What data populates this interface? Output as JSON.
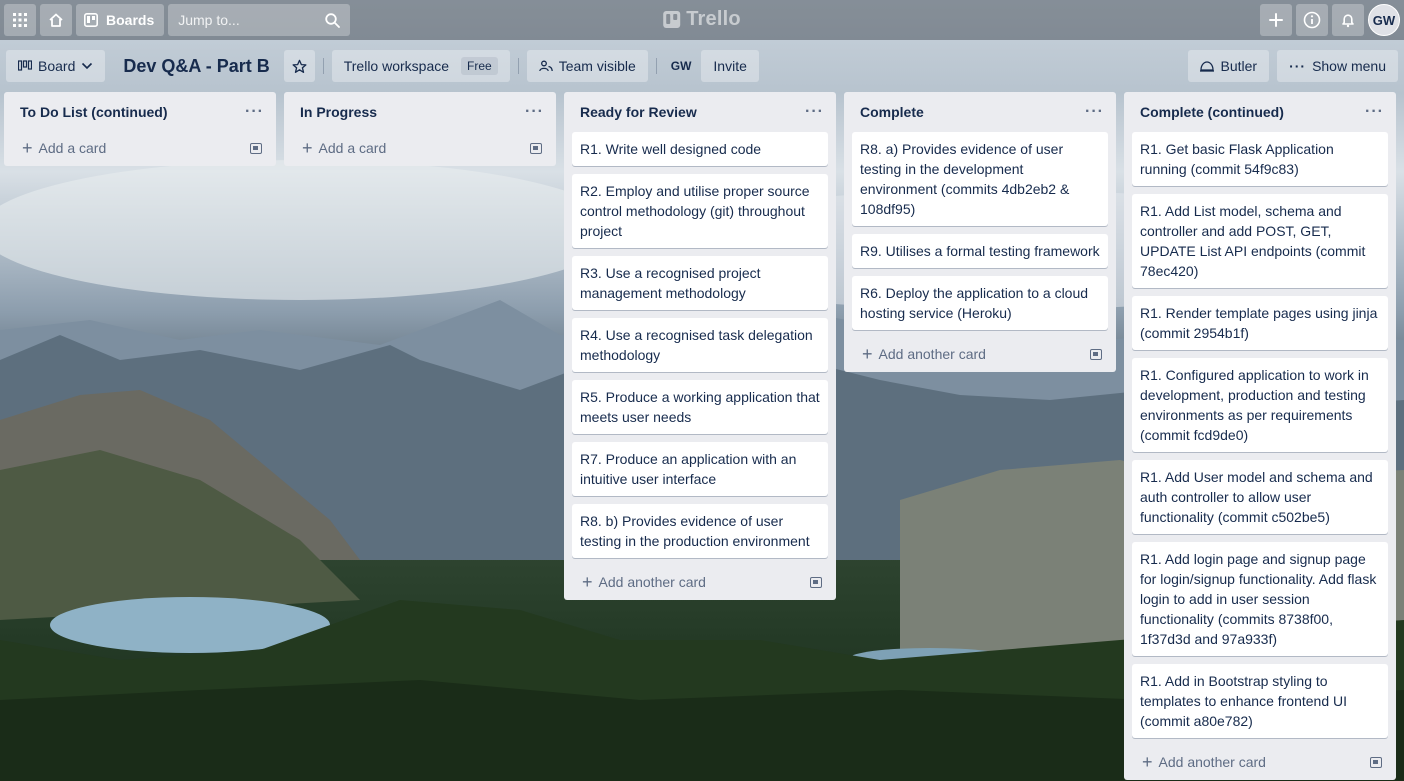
{
  "topbar": {
    "boards_label": "Boards",
    "search_placeholder": "Jump to...",
    "logo_text": "Trello",
    "avatar_initials": "GW"
  },
  "board": {
    "view_label": "Board",
    "title": "Dev Q&A - Part B",
    "workspace_label": "Trello workspace",
    "workspace_badge": "Free",
    "visibility_label": "Team visible",
    "member_initials": "GW",
    "invite_label": "Invite",
    "butler_label": "Butler",
    "show_menu_label": "Show menu"
  },
  "lists": [
    {
      "title": "To Do List (continued)",
      "cards": [],
      "add_label": "Add a card"
    },
    {
      "title": "In Progress",
      "cards": [],
      "add_label": "Add a card"
    },
    {
      "title": "Ready for Review",
      "cards": [
        "R1. Write well designed code",
        "R2. Employ and utilise proper source control methodology (git) throughout project",
        "R3. Use a recognised project management methodology",
        "R4. Use a recognised task delegation methodology",
        "R5. Produce a working application that meets user needs",
        "R7. Produce an application with an intuitive user interface",
        "R8. b) Provides evidence of user testing in the production environment"
      ],
      "add_label": "Add another card"
    },
    {
      "title": "Complete",
      "cards": [
        "R8. a) Provides evidence of user testing in the development environment (commits 4db2eb2 & 108df95)",
        "R9. Utilises a formal testing framework",
        "R6. Deploy the application to a cloud hosting service (Heroku)"
      ],
      "add_label": "Add another card"
    },
    {
      "title": "Complete (continued)",
      "cards": [
        "R1. Get basic Flask Application running (commit 54f9c83)",
        "R1. Add List model, schema and controller and add POST, GET, UPDATE List API endpoints (commit 78ec420)",
        "R1. Render template pages using jinja (commit 2954b1f)",
        "R1. Configured application to work in development, production and testing environments as per requirements (commit fcd9de0)",
        "R1. Add User model and schema and auth controller to allow user functionality (commit c502be5)",
        "R1. Add login page and signup page for login/signup functionality. Add flask login to add in user session functionality (commits 8738f00, 1f37d3d and 97a933f)",
        "R1. Add in Bootstrap styling to templates to enhance frontend UI (commit a80e782)"
      ],
      "add_label": "Add another card"
    }
  ]
}
